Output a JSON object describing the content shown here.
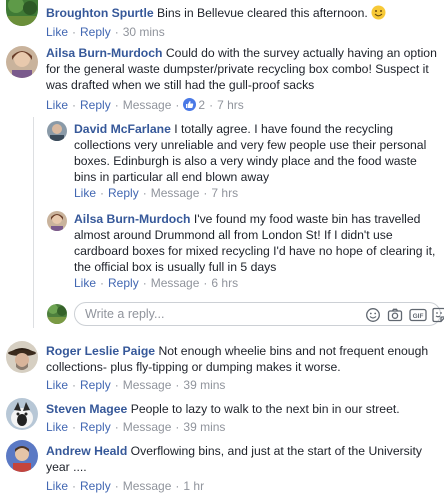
{
  "actions": {
    "like": "Like",
    "reply": "Reply",
    "message": "Message"
  },
  "comments": [
    {
      "author": "Broughton Spurtle",
      "text": "Bins in Bellevue cleared this afternoon.",
      "time": "30 mins"
    },
    {
      "author": "Ailsa Burn-Murdoch",
      "text": "Could do with the survey actually having an option for the general waste dumpster/private recycling box combo! Suspect it was drafted when we still had the gull-proof sacks",
      "reaction_count": "2",
      "time": "7 hrs"
    },
    {
      "author": "Roger Leslie Paige",
      "text": "Not enough wheelie bins and not frequent enough collections- plus fly-tipping or dumping makes it worse.",
      "time": "39 mins"
    },
    {
      "author": "Steven Magee",
      "text": "People to lazy to walk to the next bin in our street.",
      "time": "39 mins"
    },
    {
      "author": "Andrew Heald",
      "text": "Overflowing bins, and just at the start of the University year ....",
      "time": "1 hr"
    }
  ],
  "replies": [
    {
      "author": "David McFarlane",
      "text": "I totally agree. I have found the recycling collections very unreliable and very few people use their personal boxes. Edinburgh is also a very windy place and the food waste bins in particular all end blown away",
      "time": "7 hrs"
    },
    {
      "author": "Ailsa Burn-Murdoch",
      "text": "I've found my food waste bin has travelled almost around Drummond all from London St! If I didn't use cardboard boxes for mixed recycling I'd have no hope of clearing it, the official box is usually full in 5 days",
      "time": "6 hrs"
    }
  ],
  "reply_box": {
    "placeholder": "Write a reply..."
  },
  "colors": {
    "link": "#365899",
    "action_link": "#4267b2",
    "muted": "#90949c",
    "reaction_like": "#4a79e6"
  }
}
